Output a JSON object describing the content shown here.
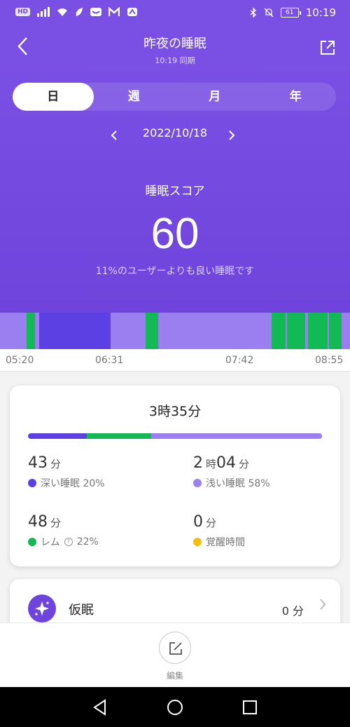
{
  "colors": {
    "hero_bg": "#7a4fe4",
    "deep": "#5d40e4",
    "light": "#9b7ef0",
    "rem": "#12b955",
    "awake": "#f5bf0f"
  },
  "status_bar": {
    "hd": "HD",
    "battery": "61",
    "time": "10:19"
  },
  "header": {
    "title": "昨夜の睡眠",
    "sync": "10:19 同期"
  },
  "tabs": [
    {
      "label": "日",
      "active": true
    },
    {
      "label": "週",
      "active": false
    },
    {
      "label": "月",
      "active": false
    },
    {
      "label": "年",
      "active": false
    }
  ],
  "date_nav": {
    "date": "2022/10/18"
  },
  "score": {
    "label": "睡眠スコア",
    "value": "60",
    "description": "11%のユーザーよりも良い睡眠です"
  },
  "timeline": {
    "ticks": [
      "05:20",
      "06:31",
      "07:42",
      "08:55"
    ]
  },
  "summary": {
    "total": "3時35分",
    "bar_fractions": {
      "deep": 0.2,
      "rem": 0.22,
      "light": 0.58
    },
    "stats": {
      "deep": {
        "value": "43",
        "unit": "分",
        "label": "深い睡眠 20%"
      },
      "light": {
        "value": "2",
        "unit1": "時",
        "value2": "04",
        "unit2": "分",
        "label": "浅い睡眠 58%"
      },
      "rem": {
        "value": "48",
        "unit": "分",
        "label": "レム",
        "pct": "22%",
        "help_icon": "question-icon"
      },
      "awake": {
        "value": "0",
        "unit": "分",
        "label": "覚醒時間"
      }
    }
  },
  "nap": {
    "label": "仮眠",
    "value": "0 分",
    "icon": "sparkle-icon"
  },
  "edit": {
    "label": "編集",
    "icon": "edit-icon"
  }
}
